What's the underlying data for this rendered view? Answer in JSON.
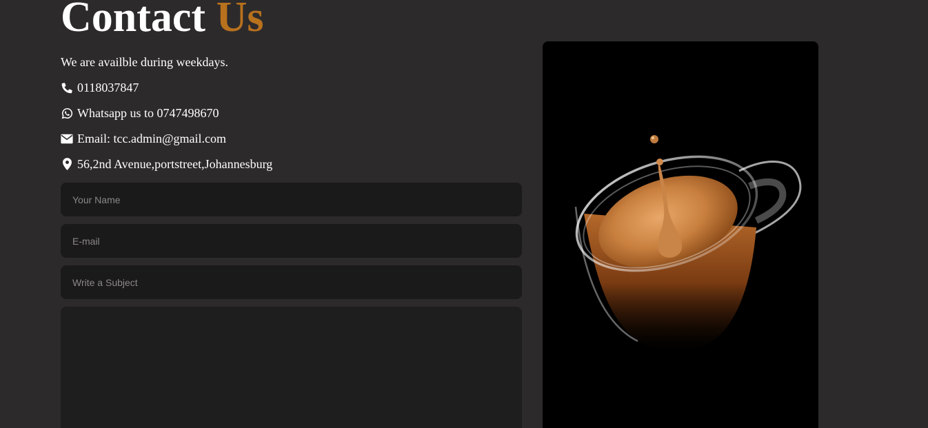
{
  "header": {
    "title_main": "Contact",
    "title_accent": "Us"
  },
  "contact": {
    "availability": "We are availble during weekdays.",
    "phone": "0118037847",
    "whatsapp": "Whatsapp us to 0747498670",
    "email": "Email: tcc.admin@gmail.com",
    "address": "56,2nd Avenue,portstreet,Johannesburg"
  },
  "form": {
    "name_placeholder": "Your Name",
    "email_placeholder": "E-mail",
    "subject_placeholder": "Write a Subject"
  },
  "colors": {
    "background": "#2d2a2b",
    "accent": "#b8711d",
    "field": "#1b1a1b",
    "text": "#ffffff"
  },
  "icons": {
    "phone": "phone-icon",
    "whatsapp": "whatsapp-icon",
    "email": "envelope-icon",
    "address": "map-marker-icon"
  }
}
